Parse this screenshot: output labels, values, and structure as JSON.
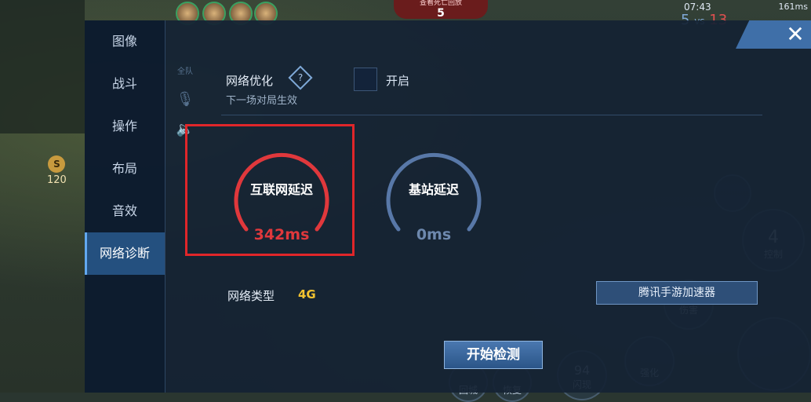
{
  "hud": {
    "clock": "07:43",
    "death_label": "查看死亡回放",
    "death_count": "5",
    "score_blue": "5",
    "score_sep": "vs",
    "score_red": "13",
    "network": "161ms",
    "gold": "120",
    "gold_icon": "S"
  },
  "sidebar": {
    "items": [
      {
        "label": "图像"
      },
      {
        "label": "战斗"
      },
      {
        "label": "操作"
      },
      {
        "label": "布局"
      },
      {
        "label": "音效"
      },
      {
        "label": "网络诊断"
      }
    ]
  },
  "settings": {
    "opt_title": "网络优化",
    "opt_help": "?",
    "opt_sub": "下一场对局生效",
    "checkbox_label": "开启",
    "internet_latency_label": "互联网延迟",
    "internet_latency_value": "342ms",
    "station_latency_label": "基站延迟",
    "station_latency_value": "0ms",
    "network_type_label": "网络类型",
    "network_type_value": "4G",
    "accelerator_button": "腾讯手游加速器",
    "start_button": "开始检测"
  },
  "side_icons": [
    "全队",
    "mic",
    "speaker"
  ],
  "skills": {
    "control_num": "4",
    "control_label": "控制",
    "recall_label": "回城",
    "restore_label": "恢复",
    "flash_num": "94",
    "flash_label": "闪现",
    "upgrade_label": "强化",
    "damage_label": "伤害"
  },
  "colors": {
    "gauge_internet": "#e0383c",
    "gauge_station": "#5878a8",
    "highlight": "#e0262a",
    "network_type": "#f2c230"
  }
}
